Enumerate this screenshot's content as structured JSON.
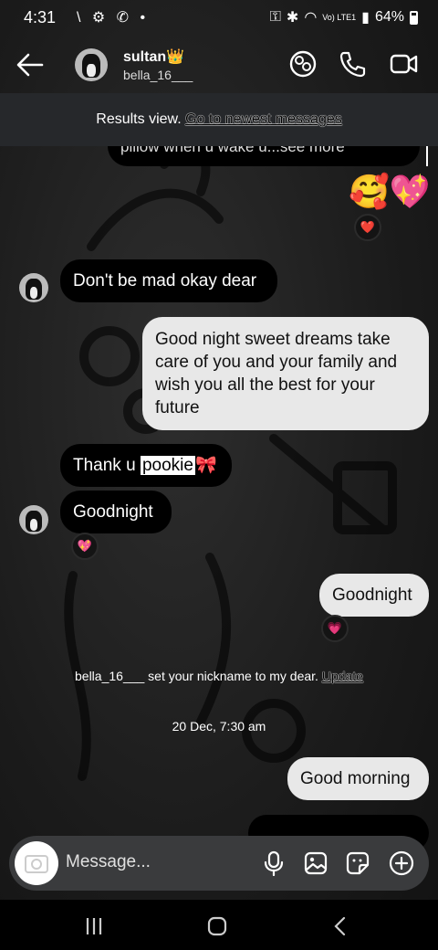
{
  "status_bar": {
    "time": "4:31",
    "left_icons": "\\ ⚙ ✆ •",
    "network": "Vo) LTE1",
    "battery": "64%"
  },
  "header": {
    "name": "sultan👑",
    "username": "bella_16___"
  },
  "banner": {
    "text": "Results view.",
    "link": "Go to newest messages"
  },
  "messages": {
    "clipped_text": "pillow when u wake u...see more",
    "top_emoji": "🥰💖",
    "top_reaction": "❤️",
    "m1": "Don't be mad okay dear",
    "m2": "Good night sweet dreams take care of you and your family and wish you all the best for your future",
    "m3_prefix": "Thank u ",
    "m3_highlight": "pookie",
    "m3_suffix": "🎀",
    "m4": "Goodnight",
    "m4_reaction": "💖",
    "m5": "Goodnight",
    "m5_reaction": "💗",
    "system_text": "bella_16___ set your nickname to my dear.",
    "system_link": "Update",
    "timestamp": "20 Dec, 7:30 am",
    "m6": "Good morning"
  },
  "composer": {
    "placeholder": "Message..."
  },
  "colors": {
    "incoming_bubble": "#000000",
    "outgoing_bubble": "#e8e8e8",
    "banner_bg": "#26282b",
    "composer_bg": "#3a3b3d"
  }
}
